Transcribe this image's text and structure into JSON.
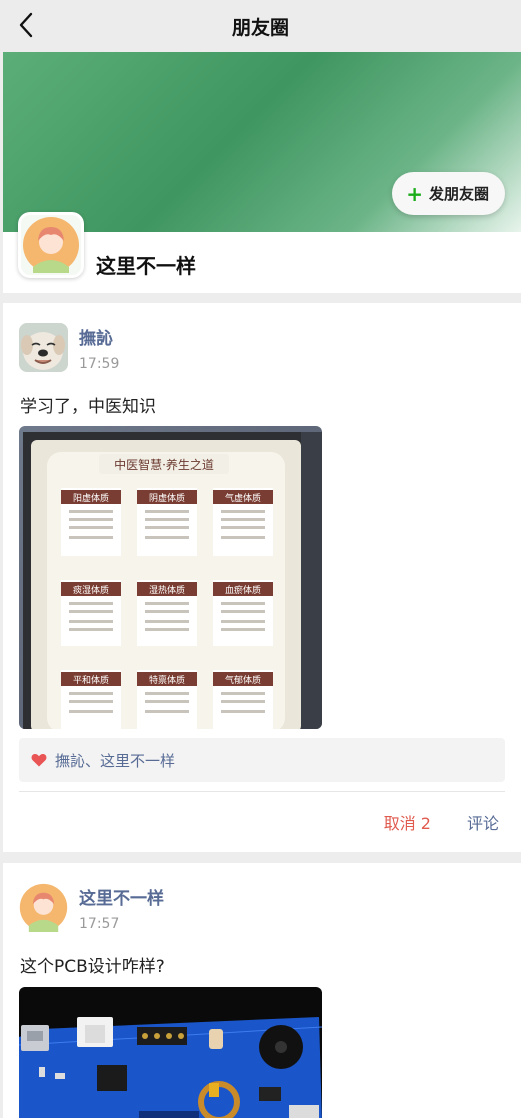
{
  "header": {
    "title": "朋友圈"
  },
  "cover": {
    "post_button_label": "发朋友圈"
  },
  "profile": {
    "name": "这里不一样"
  },
  "posts": [
    {
      "author": "撫訫",
      "time": "17:59",
      "text": "学习了，中医知识",
      "image": {
        "board_title": "中医智慧·养生之道",
        "panels": [
          "阳虚体质",
          "阴虚体质",
          "气虚体质",
          "痰湿体质",
          "湿热体质",
          "血瘀体质",
          "平和体质",
          "特禀体质",
          "气郁体质"
        ]
      },
      "likes": "撫訫、这里不一样",
      "cancel_label": "取消 2",
      "comment_label": "评论"
    },
    {
      "author": "这里不一样",
      "time": "17:57",
      "text": "这个PCB设计咋样?"
    }
  ],
  "colors": {
    "link": "#576b95",
    "accent_green": "#1aad19",
    "like_red": "#e95454",
    "cancel_red": "#e05a4e"
  }
}
